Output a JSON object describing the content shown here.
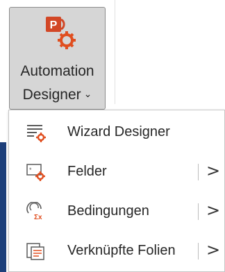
{
  "ribbon": {
    "button": {
      "label_line1": "Automation",
      "label_line2": "Designer",
      "dropdown_glyph": "⌄",
      "icon": "powerpoint-gear-icon"
    }
  },
  "menu": {
    "items": [
      {
        "label": "Wizard Designer",
        "icon": "wizard-list-gear-icon",
        "has_submenu": false
      },
      {
        "label": "Felder",
        "icon": "field-gear-icon",
        "has_submenu": true,
        "arrow": ">"
      },
      {
        "label": "Bedingungen",
        "icon": "condition-formula-icon",
        "has_submenu": true,
        "arrow": ">"
      },
      {
        "label": "Verknüpfte Folien",
        "icon": "linked-slides-icon",
        "has_submenu": true,
        "arrow": ">"
      }
    ]
  },
  "colors": {
    "button_pressed": "#d6d6d6",
    "powerpoint_orange": "#d24726",
    "gear_orange": "#e04e1f",
    "window_blue": "#1d3f7a"
  }
}
